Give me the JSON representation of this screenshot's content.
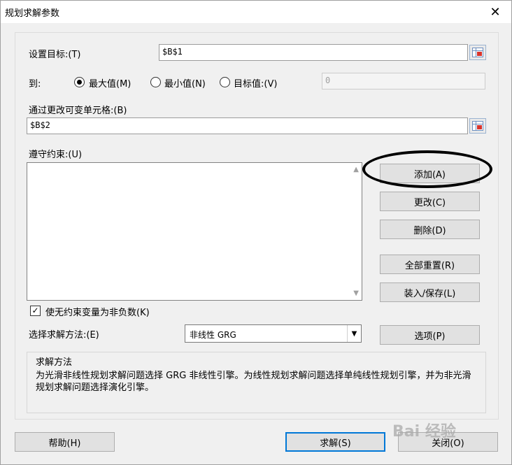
{
  "title": "规划求解参数",
  "labels": {
    "set_objective": "设置目标:(T)",
    "to": "到:",
    "by_changing": "通过更改可变单元格:(B)",
    "subject_to": "遵守约束:(U)",
    "make_nonneg": "使无约束变量为非负数(K)",
    "solving_method": "选择求解方法:(E)",
    "group_title": "求解方法",
    "description": "为光滑非线性规划求解问题选择 GRG 非线性引擎。为线性规划求解问题选择单纯线性规划引擎，并为非光滑规划求解问题选择演化引擎。"
  },
  "inputs": {
    "objective": "$B$1",
    "changing_cells": "$B$2",
    "value_of": "0"
  },
  "radios": {
    "max": "最大值(M)",
    "min": "最小值(N)",
    "value": "目标值:(V)",
    "selected": "max"
  },
  "buttons": {
    "add": "添加(A)",
    "change": "更改(C)",
    "delete": "删除(D)",
    "reset_all": "全部重置(R)",
    "load_save": "装入/保存(L)",
    "options": "选项(P)",
    "help": "帮助(H)",
    "solve": "求解(S)",
    "close": "关闭(O)"
  },
  "method": {
    "selected": "非线性 GRG"
  },
  "checkbox_checked": true,
  "watermark": "Bai 经验"
}
